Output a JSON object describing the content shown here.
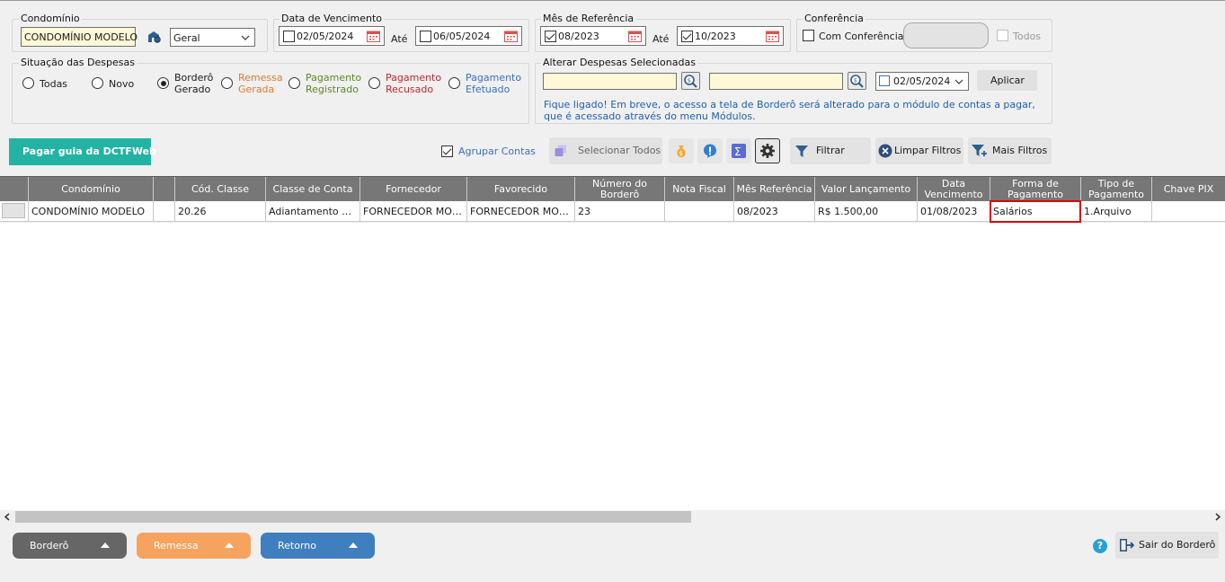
{
  "filters": {
    "condominio": {
      "title": "Condomínio",
      "value": "CONDOMÍNIO MODELO",
      "select": "Geral"
    },
    "vencimento": {
      "title": "Data de Vencimento",
      "from": "02/05/2024",
      "to": "06/05/2024",
      "ate": "Até"
    },
    "referencia": {
      "title": "Mês de Referência",
      "from": "08/2023",
      "to": "10/2023",
      "ate": "Até"
    },
    "conferencia": {
      "title": "Conferência",
      "com": "Com Conferência",
      "todos": "Todos"
    },
    "situacao": {
      "title": "Situação das Despesas",
      "todas": "Todas",
      "novo": "Novo",
      "bordero": [
        "Borderô",
        "Gerado"
      ],
      "remessa": [
        "Remessa",
        "Gerada"
      ],
      "pag_reg": [
        "Pagamento",
        "Registrado"
      ],
      "pag_rec": [
        "Pagamento",
        "Recusado"
      ],
      "pag_efe": [
        "Pagamento",
        "Efetuado"
      ]
    },
    "alterar": {
      "title": "Alterar Despesas Selecionadas",
      "date": "02/05/2024",
      "apply": "Aplicar",
      "notice": [
        "Fique ligado! Em breve, o acesso a tela de Borderô será alterado para o módulo de contas a pagar,",
        "que é acessado através do menu Módulos."
      ]
    }
  },
  "toolbar": {
    "pagar": "Pagar guia da DCTFWeb",
    "agrupar": "Agrupar Contas",
    "selecionar": "Selecionar Todos",
    "filtrar": "Filtrar",
    "limpar": "Limpar Filtros",
    "mais": "Mais Filtros"
  },
  "grid": {
    "columns": [
      [
        "Condomínio"
      ],
      [
        "Cód. Classe"
      ],
      [
        "Classe de Conta"
      ],
      [
        "Fornecedor"
      ],
      [
        "Favorecido"
      ],
      [
        "Número do",
        "Borderô"
      ],
      [
        "Nota Fiscal"
      ],
      [
        "Mês Referência"
      ],
      [
        "Valor Lançamento"
      ],
      [
        "Data",
        "Vencimento"
      ],
      [
        "Forma de",
        "Pagamento"
      ],
      [
        "Tipo de",
        "Pagamento"
      ],
      [
        "Chave PIX"
      ]
    ],
    "rows": [
      [
        "CONDOMÍNIO MODELO",
        "20.26",
        "Adiantamento de Salários",
        "FORNECEDOR MODELO",
        "FORNECEDOR MODELO",
        "23",
        "",
        "08/2023",
        "R$ 1.500,00",
        "01/08/2023",
        "Salários",
        "1.Arquivo",
        ""
      ]
    ]
  },
  "footer": {
    "bordero": "Borderô",
    "remessa": "Remessa",
    "retorno": "Retorno",
    "sair": "Sair do Borderô"
  },
  "colors": {
    "teal": "#23b3a4",
    "bordero": "#666666",
    "remessa": "#f5a35f",
    "retorno": "#3f7fbf",
    "highlight": "#e00000"
  }
}
